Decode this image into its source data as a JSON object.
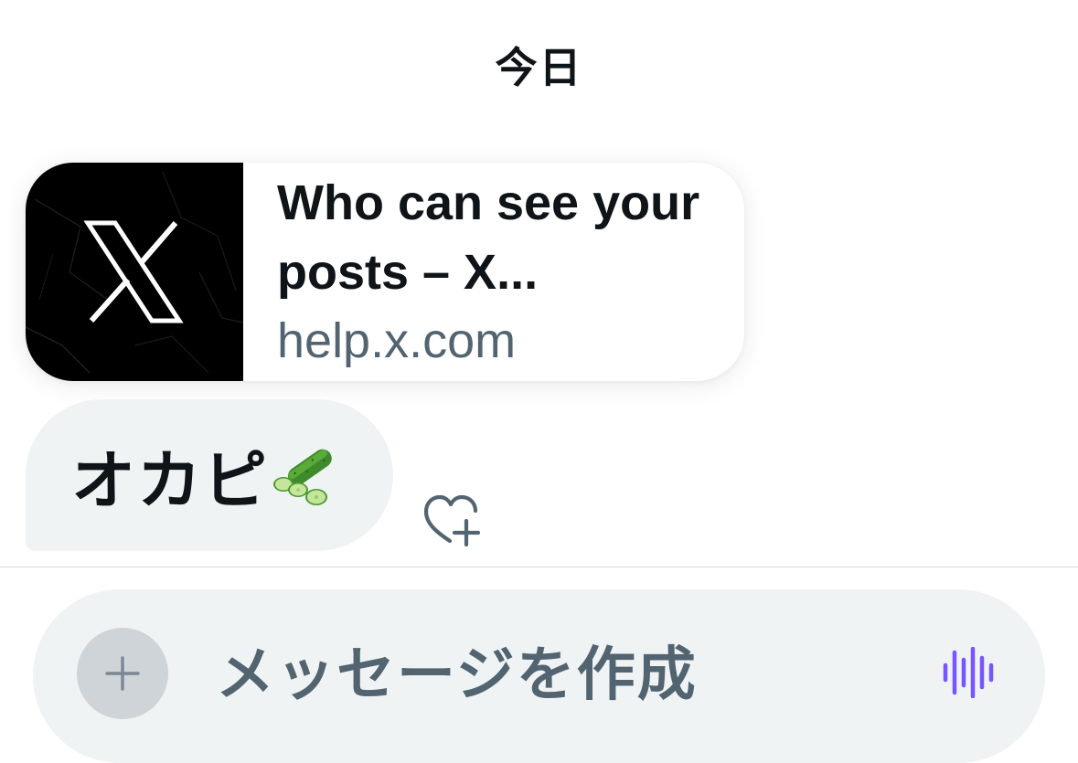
{
  "conversation": {
    "date_separator": "今日"
  },
  "link_preview": {
    "title": "Who can see your posts – X...",
    "domain": "help.x.com",
    "thumbnail_icon": "x-logo-icon"
  },
  "message": {
    "text": "オカピ",
    "emoji_icon": "cucumber-emoji-icon"
  },
  "reaction": {
    "icon": "heart-plus-icon"
  },
  "composer": {
    "placeholder": "メッセージを作成",
    "value": "",
    "add_icon": "plus-icon",
    "voice_icon": "voice-waveform-icon"
  },
  "colors": {
    "accent_voice": "#7856ff",
    "secondary_text": "#536471",
    "bubble_bg": "#eff3f4"
  }
}
